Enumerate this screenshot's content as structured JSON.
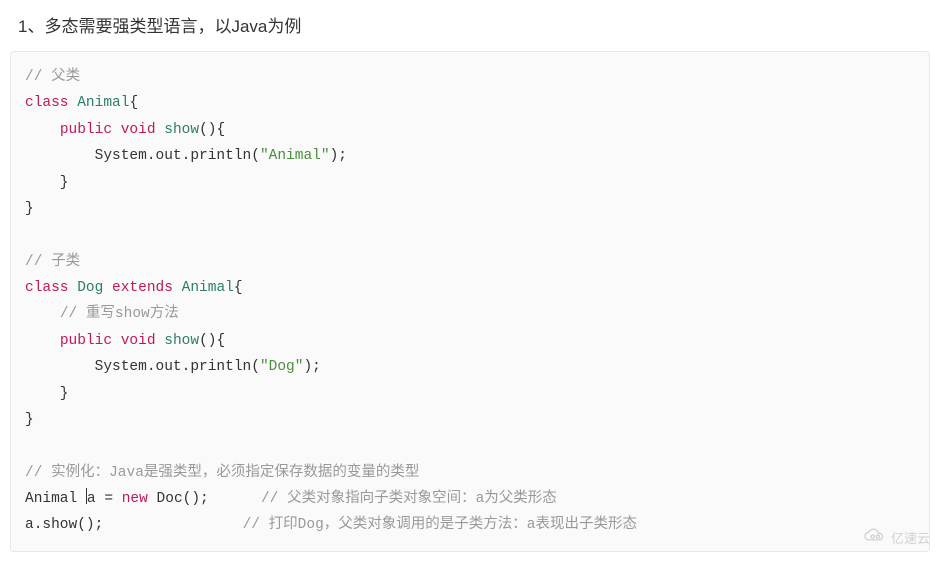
{
  "heading": "1、多态需要强类型语言，以Java为例",
  "code": {
    "comment_parent": "// 父类",
    "kw_class1": "class",
    "name_animal": "Animal",
    "brace_open1": "{",
    "kw_public1": "public",
    "kw_void1": "void",
    "fn_show1": "show",
    "paren_open1": "(){",
    "print_animal_pre": "        System.out.println(",
    "str_animal": "\"Animal\"",
    "print_animal_post": ");",
    "brace_close_m1": "    }",
    "brace_close_c1": "}",
    "comment_child": "// 子类",
    "kw_class2": "class",
    "name_dog": "Dog",
    "kw_extends": "extends",
    "name_animal2": "Animal",
    "brace_open2": "{",
    "comment_override": "// 重写show方法",
    "kw_public2": "public",
    "kw_void2": "void",
    "fn_show2": "show",
    "paren_open2": "(){",
    "print_dog_pre": "        System.out.println(",
    "str_dog": "\"Dog\"",
    "print_dog_post": ");",
    "brace_close_m2": "    }",
    "brace_close_c2": "}",
    "comment_inst": "// 实例化：Java是强类型，必须指定保存数据的变量的类型",
    "inst_type": "Animal ",
    "inst_var": "a",
    "inst_eq": " = ",
    "kw_new": "new",
    "inst_doc": " Doc();",
    "inst_pad1": "      ",
    "comment_line1": "// 父类对象指向子类对象空间：a为父类形态",
    "call_show": "a.show();",
    "call_pad": "                ",
    "comment_line2": "// 打印Dog，父类对象调用的是子类方法：a表现出子类形态"
  },
  "watermark": "亿速云"
}
